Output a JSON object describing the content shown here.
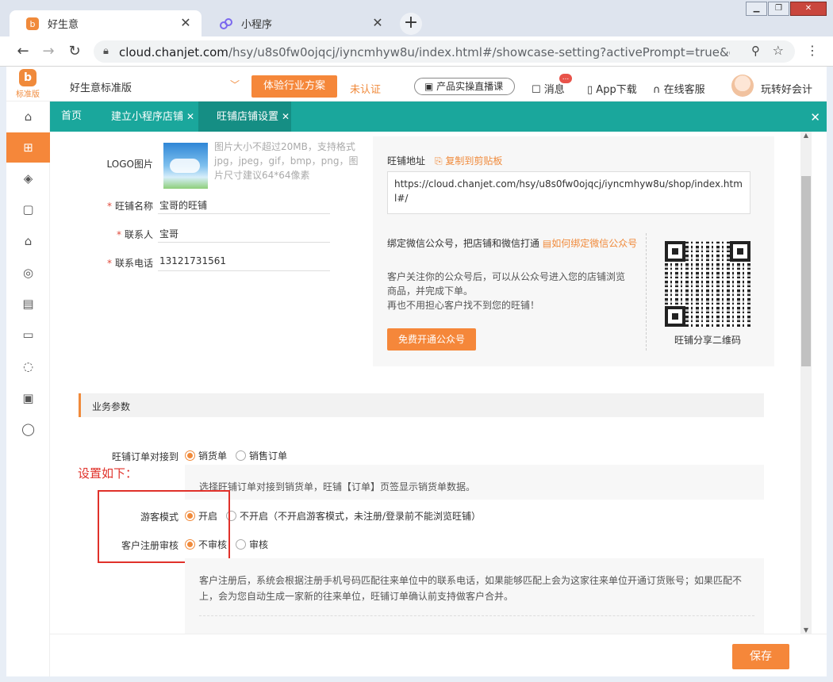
{
  "browser": {
    "tabs": [
      {
        "title": "好生意",
        "active": true
      },
      {
        "title": "小程序",
        "active": false
      }
    ],
    "new_tab": "+",
    "url_host": "cloud.chanjet.com",
    "url_rest": "/hsy/u8s0fw0ojqcj/iyncmhyw8u/index.html#/showcase-setting?activePrompt=true&closeProm..."
  },
  "header": {
    "logo_label": "标准版",
    "edition": "好生意标准版",
    "experience_button": "体验行业方案",
    "unverified": "未认证",
    "live_course": "产品实操直播课",
    "messages": "消息",
    "app_download": "App下载",
    "online_service": "在线客服",
    "username": "玩转好会计",
    "badge": "..."
  },
  "page_tabs": [
    {
      "label": "首页",
      "closable": false
    },
    {
      "label": "建立小程序店铺",
      "closable": true
    },
    {
      "label": "旺铺店铺设置",
      "closable": true,
      "active": true
    }
  ],
  "store_form": {
    "logo_label": "LOGO图片",
    "logo_hint": [
      "图片大小不超过20MB，支持格式",
      "jpg，jpeg，gif，bmp，png，图",
      "片尺寸建议64*64像素"
    ],
    "name_label": "旺铺名称",
    "name_value": "宝哥的旺铺",
    "contact_label": "联系人",
    "contact_value": "宝哥",
    "phone_label": "联系电话",
    "phone_value": "13121731561"
  },
  "right_panel": {
    "address_label": "旺铺地址",
    "copy_link": "复制到剪贴板",
    "address_value": "https://cloud.chanjet.com/hsy/u8s0fw0ojqcj/iyncmhyw8u/shop/index.html#/",
    "bind_title": "绑定微信公众号，把店铺和微信打通",
    "bind_link": "如何绑定微信公众号",
    "bind_desc": [
      "客户关注你的公众号后，可以从公众号进入您的店铺浏览",
      "商品，并完成下单。",
      "再也不用担心客户找不到您的旺铺！"
    ],
    "open_button": "免费开通公众号",
    "qr_caption": "旺铺分享二维码"
  },
  "business": {
    "section_title": "业务参数",
    "order_label": "旺铺订单对接到",
    "order_options": [
      "销货单",
      "销售订单"
    ],
    "order_desc": "选择旺铺订单对接到销货单，旺铺【订单】页签显示销货单数据。",
    "annotation": "设置如下：",
    "guest_label": "游客模式",
    "guest_on": "开启",
    "guest_off": "不开启（不开启游客模式，未注册/登录前不能浏览旺铺）",
    "review_label": "客户注册审核",
    "review_off": "不审核",
    "review_on": "审核",
    "review_desc": [
      "客户注册后，系统会根据注册手机号码匹配往来单位中的联系电话，如果能够匹配上会为这家往来单位开通订货账号；如果匹配不",
      "上，会为您自动生成一家新的往来单位，旺铺订单确认前支持做客户合并。"
    ]
  },
  "footer": {
    "save_button": "保存"
  },
  "colors": {
    "accent": "#f5873a",
    "teal": "#1aa79c",
    "annotation_red": "#e0312a"
  }
}
